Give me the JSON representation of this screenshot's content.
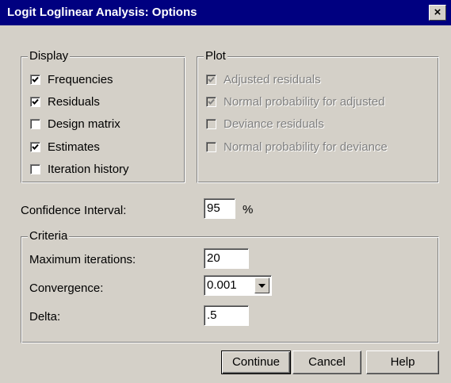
{
  "window": {
    "title": "Logit Loglinear Analysis: Options",
    "close_glyph": "×"
  },
  "display": {
    "label": "Display",
    "items": [
      {
        "label": "Frequencies",
        "checked": true
      },
      {
        "label": "Residuals",
        "checked": true
      },
      {
        "label": "Design matrix",
        "checked": false
      },
      {
        "label": "Estimates",
        "checked": true
      },
      {
        "label": "Iteration history",
        "checked": false
      }
    ]
  },
  "plot": {
    "label": "Plot",
    "items": [
      {
        "label": "Adjusted residuals",
        "checked": true,
        "disabled": true
      },
      {
        "label": "Normal probability for adjusted",
        "checked": true,
        "disabled": true
      },
      {
        "label": "Deviance residuals",
        "checked": false,
        "disabled": true
      },
      {
        "label": "Normal probability for deviance",
        "checked": false,
        "disabled": true
      }
    ]
  },
  "confidence": {
    "label": "Confidence Interval:",
    "value": "95",
    "unit": "%"
  },
  "criteria": {
    "label": "Criteria",
    "max_iter_label": "Maximum iterations:",
    "max_iter_value": "20",
    "convergence_label": "Convergence:",
    "convergence_value": "0.001",
    "delta_label": "Delta:",
    "delta_value": ".5"
  },
  "buttons": {
    "continue": "Continue",
    "cancel": "Cancel",
    "help": "Help"
  },
  "icons": {
    "close": "close-icon",
    "check": "checkmark-icon",
    "dropdown": "chevron-down-icon"
  }
}
